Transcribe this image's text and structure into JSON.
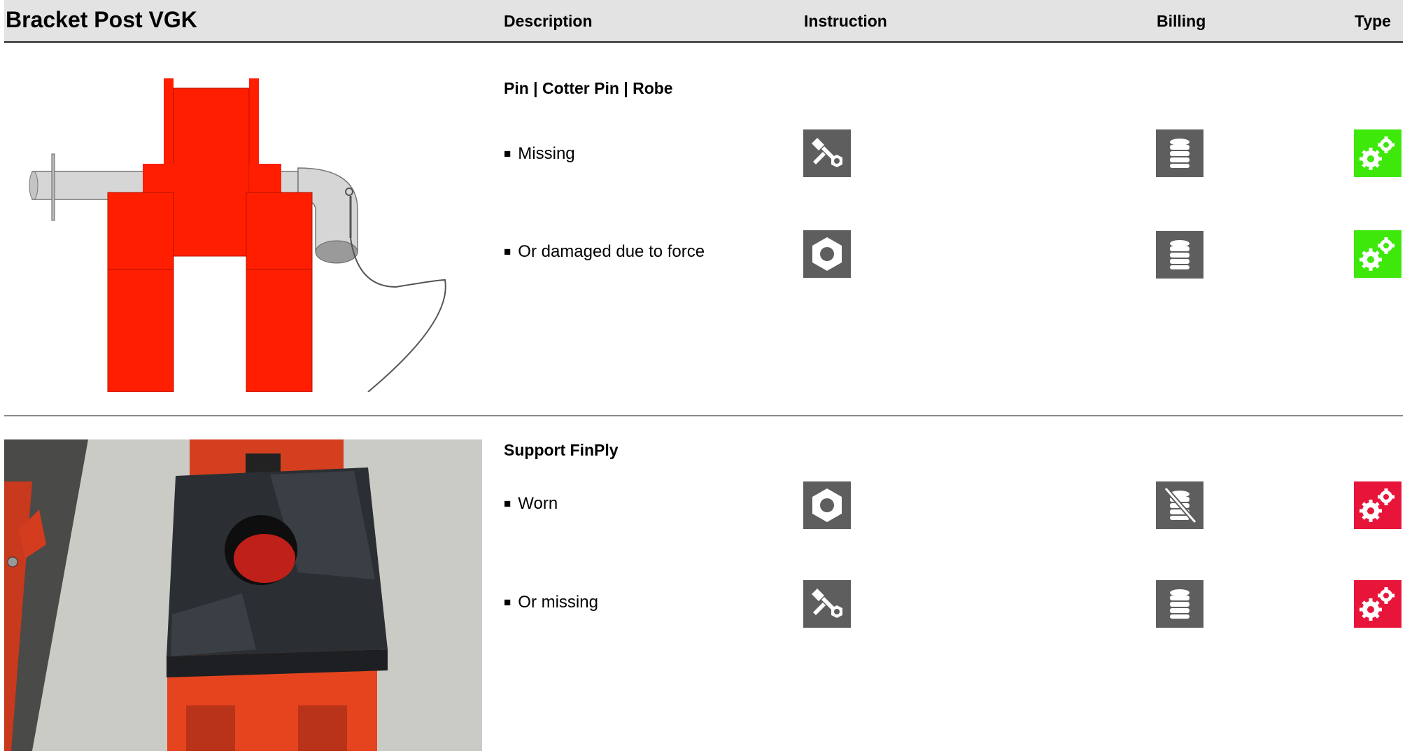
{
  "header": {
    "title": "Bracket Post VGK",
    "col_description": "Description",
    "col_instruction": "Instruction",
    "col_billing": "Billing",
    "col_type": "Type"
  },
  "sections": [
    {
      "title": "Pin | Cotter Pin | Robe",
      "image": "bracket-post-pin-render",
      "items": [
        {
          "text": "Missing",
          "instruction_icon": "bolt-nut-icon",
          "billing_icon": "coin-stack-icon",
          "type_icon": "gears-icon",
          "type_color": "#3ee80a"
        },
        {
          "text": "Or damaged due to force",
          "instruction_icon": "nut-icon",
          "billing_icon": "coin-stack-icon",
          "type_icon": "gears-icon",
          "type_color": "#3ee80a"
        }
      ]
    },
    {
      "title": "Support FinPly",
      "image": "support-finply-photo",
      "items": [
        {
          "text": "Worn",
          "instruction_icon": "nut-icon",
          "billing_icon": "no-billing-icon",
          "type_icon": "gears-icon",
          "type_color": "#e8153b"
        },
        {
          "text": "Or missing",
          "instruction_icon": "bolt-nut-icon",
          "billing_icon": "coin-stack-icon",
          "type_icon": "gears-icon",
          "type_color": "#e8153b"
        }
      ]
    }
  ],
  "bullet": "■",
  "colors": {
    "header_bg": "#e3e3e3",
    "icon_gray": "#5e5e5e",
    "type_green": "#3ee80a",
    "type_red": "#e8153b"
  }
}
